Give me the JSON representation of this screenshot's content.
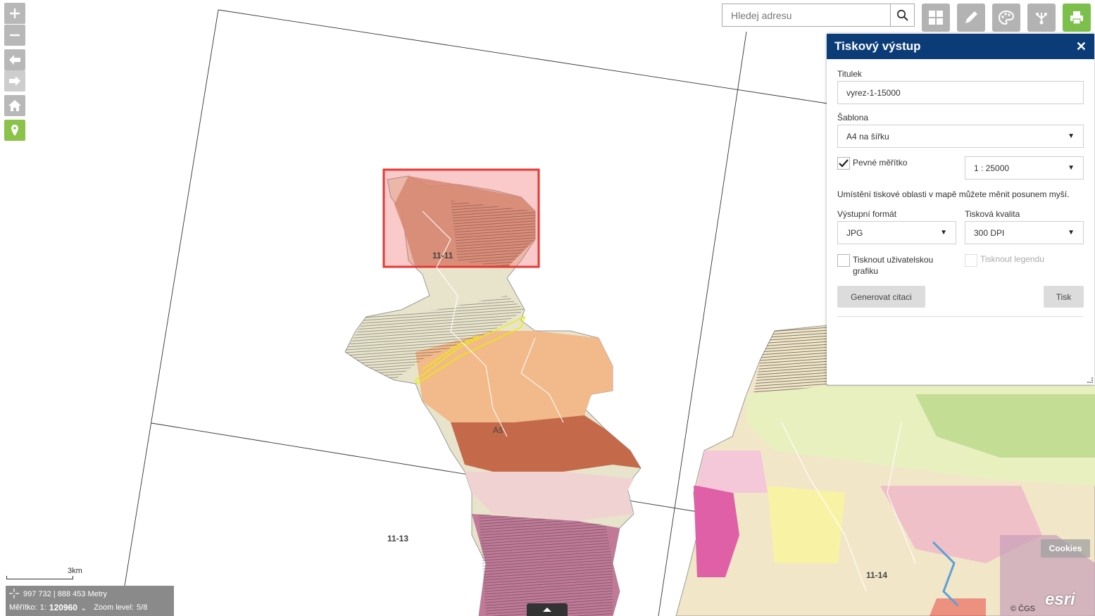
{
  "search": {
    "placeholder": "Hledej adresu"
  },
  "toolbar": {
    "items": [
      "grid-icon",
      "pencil-icon",
      "palette-icon",
      "share-icon",
      "printer-icon"
    ]
  },
  "nav": {
    "items": [
      "zoom-in-icon",
      "zoom-out-icon",
      "back-arrow-icon",
      "forward-arrow-icon",
      "home-icon",
      "location-pin-icon"
    ]
  },
  "print_panel": {
    "title": "Tiskový výstup",
    "close": "✕",
    "title_label": "Titulek",
    "title_value": "vyrez-1-15000",
    "template_label": "Šablona",
    "template_value": "A4 na šířku",
    "fixed_scale_label": "Pevné měřítko",
    "fixed_scale_checked": true,
    "scale_value": "1 : 25000",
    "hint": "Umístění tiskové oblasti v mapě můžete měnit posunem myší.",
    "format_label": "Výstupní formát",
    "format_value": "JPG",
    "quality_label": "Tisková kvalita",
    "quality_value": "300 DPI",
    "user_graphics_label": "Tisknout uživatelskou grafiku",
    "legend_label": "Tisknout legendu",
    "cite_button": "Generovat citaci",
    "print_button": "Tisk"
  },
  "map": {
    "sheet_labels": [
      "11-11",
      "11-13",
      "11-14"
    ],
    "town_label": "Aš",
    "colors": {
      "print_area": "#e53935",
      "selection": "#e8f000",
      "panel_header": "#0c3c78",
      "active_tool": "#7cc04b"
    }
  },
  "status": {
    "scalebar": "3km",
    "coords": "997 732 | 888 453 Metry",
    "scale_label": "Měřítko:",
    "scale_prefix": "1:",
    "scale_value": "120960",
    "zoom_label": "Zoom level:",
    "zoom_value": "5/8"
  },
  "footer": {
    "cookies": "Cookies",
    "copyright": "© ČGS",
    "esri": "esri"
  }
}
